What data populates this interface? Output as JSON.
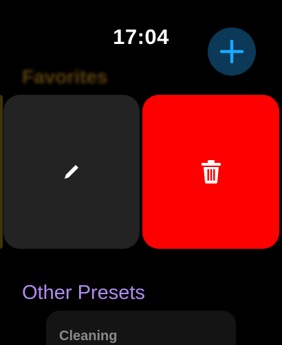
{
  "status": {
    "time": "17:04"
  },
  "favorites": {
    "title": "Favorites"
  },
  "actions": {
    "add_icon": "plus-icon",
    "edit_icon": "pencil-icon",
    "delete_icon": "trash-icon"
  },
  "other_presets": {
    "title": "Other Presets",
    "items": [
      {
        "label": "Cleaning"
      }
    ]
  },
  "colors": {
    "add_button_bg": "#0b3957",
    "add_icon": "#1aa7ff",
    "edit_tile": "#232323",
    "delete_tile": "#ff0000",
    "section_title": "#b08cf2"
  }
}
